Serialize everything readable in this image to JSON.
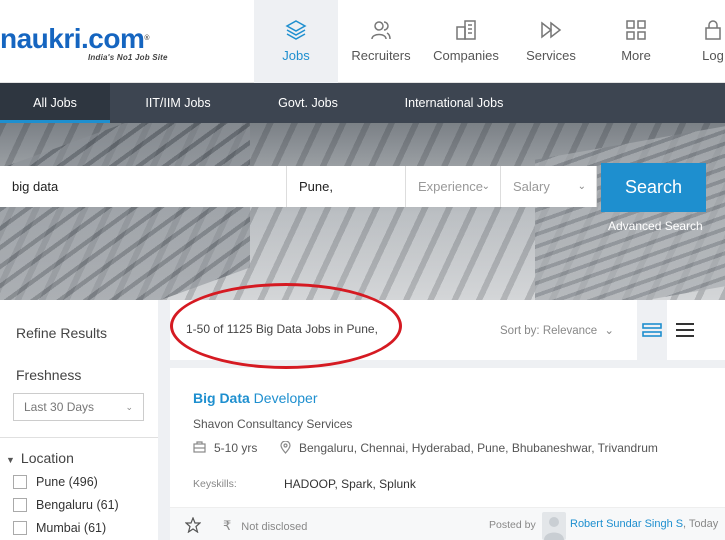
{
  "brand": {
    "logo_text": "naukri.com",
    "tagline": "India's No1 Job Site"
  },
  "topnav": [
    {
      "label": "Jobs",
      "icon": "layers-icon"
    },
    {
      "label": "Recruiters",
      "icon": "users-icon"
    },
    {
      "label": "Companies",
      "icon": "building-icon"
    },
    {
      "label": "Services",
      "icon": "forward-icon"
    },
    {
      "label": "More",
      "icon": "grid-icon"
    },
    {
      "label": "Log",
      "icon": "lock-icon"
    }
  ],
  "subnav": [
    "All Jobs",
    "IIT/IIM Jobs",
    "Govt. Jobs",
    "International Jobs"
  ],
  "search": {
    "keyword": "big data",
    "location": "Pune,",
    "experience_placeholder": "Experience",
    "salary_placeholder": "Salary",
    "button": "Search",
    "advanced": "Advanced Search"
  },
  "sidebar": {
    "title": "Refine Results",
    "freshness_label": "Freshness",
    "freshness_value": "Last 30 Days",
    "location_label": "Location",
    "locations": [
      "Pune (496)",
      "Bengaluru (61)",
      "Mumbai (61)"
    ]
  },
  "results": {
    "count_text": "1-50 of 1125 Big Data Jobs in Pune,",
    "sort_text": "Sort by: Relevance"
  },
  "job": {
    "title_bold": "Big Data",
    "title_rest": " Developer",
    "company": "Shavon Consultancy Services",
    "experience": "5-10 yrs",
    "locations": "Bengaluru, Chennai, Hyderabad, Pune, Bhubaneshwar, Trivandrum",
    "keyskills_label": "Keyskills:",
    "keyskills": "HADOOP, Spark, Splunk",
    "salary": "Not disclosed",
    "posted_by_label": "Posted by",
    "posted_by": "Robert Sundar Singh S",
    "posted_when": ", Today"
  },
  "colors": {
    "accent": "#1e8fcf",
    "subnav_bg": "#3d4551",
    "annotation": "#d51a22"
  }
}
